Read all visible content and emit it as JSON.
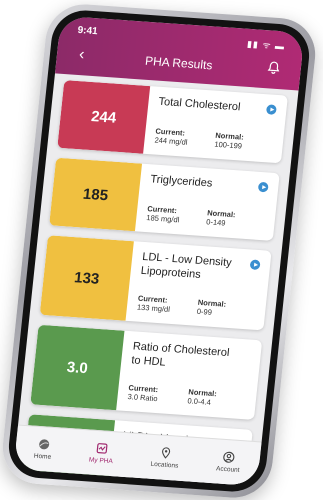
{
  "status": {
    "time": "9:41",
    "icons": "▮▮ ᯤ ▬"
  },
  "header": {
    "title": "PHA Results",
    "back_label": "‹"
  },
  "colors": {
    "header": "#a0286e",
    "red": "#c83a55",
    "yellow": "#f0c040",
    "green": "#5a9a4e"
  },
  "cards": [
    {
      "value": "244",
      "name": "Total Cholesterol",
      "current_label": "Current:",
      "current": "244 mg/dl",
      "normal_label": "Normal:",
      "normal": "100-199"
    },
    {
      "value": "185",
      "name": "Triglycerides",
      "current_label": "Current:",
      "current": "185 mg/dl",
      "normal_label": "Normal:",
      "normal": "0-149"
    },
    {
      "value": "133",
      "name": "LDL - Low Density Lipoproteins",
      "current_label": "Current:",
      "current": "133 mg/dl",
      "normal_label": "Normal:",
      "normal": "0-99"
    },
    {
      "value": "3.0",
      "name": "Ratio of Cholesterol to HDL",
      "current_label": "Current:",
      "current": "3.0 Ratio",
      "normal_label": "Normal:",
      "normal": "0.0-4.4"
    },
    {
      "value": "",
      "name": "VLDL - Very Low"
    }
  ],
  "nav": [
    {
      "label": "Home",
      "icon": "home-icon"
    },
    {
      "label": "My PHA",
      "icon": "pha-icon"
    },
    {
      "label": "Locations",
      "icon": "location-pin-icon"
    },
    {
      "label": "Account",
      "icon": "account-icon"
    }
  ]
}
